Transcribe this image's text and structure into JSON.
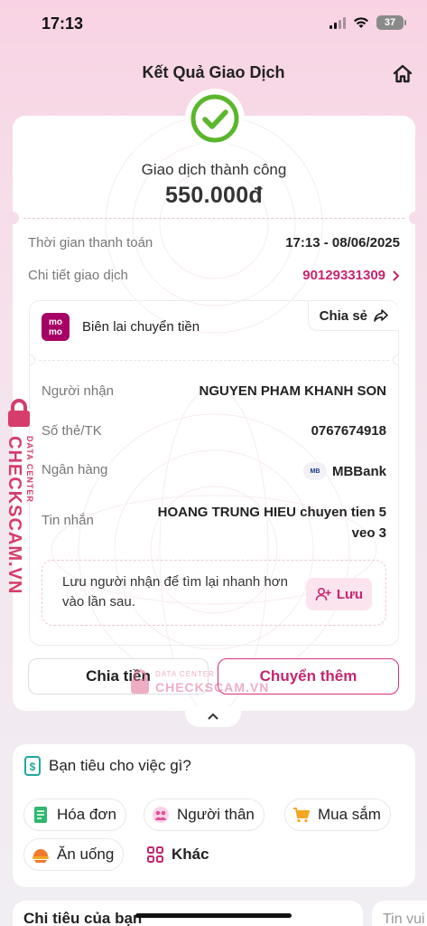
{
  "status_bar": {
    "time": "17:13",
    "battery": "37"
  },
  "header": {
    "title": "Kết Quả Giao Dịch"
  },
  "result": {
    "status": "Giao dịch thành công",
    "amount": "550.000đ",
    "payment_time_label": "Thời gian thanh toán",
    "payment_time_value": "17:13 - 08/06/2025",
    "detail_label": "Chi tiết giao dịch",
    "detail_value": "90129331309"
  },
  "receipt": {
    "logo_top": "mo",
    "logo_bottom": "mo",
    "title": "Biên lai chuyển tiền",
    "share_label": "Chia sẻ",
    "recipient_label": "Người nhận",
    "recipient_value": "NGUYEN PHAM KHANH SON",
    "account_label": "Số thẻ/TK",
    "account_value": "0767674918",
    "bank_label": "Ngân hàng",
    "bank_icon": "MB",
    "bank_value": "MBBank",
    "message_label": "Tin nhắn",
    "message_line1": "HOANG TRUNG HIEU chuyen tien 5",
    "message_line2": "veo 3",
    "save_text": "Lưu người nhận để tìm lại nhanh hơn vào lần sau.",
    "save_button": "Lưu"
  },
  "actions": {
    "split": "Chia tiền",
    "transfer_more": "Chuyển thêm"
  },
  "spending": {
    "title": "Bạn tiêu cho việc gì?",
    "categories": [
      {
        "label": "Hóa đơn",
        "icon": "bill-icon"
      },
      {
        "label": "Người thân",
        "icon": "family-icon"
      },
      {
        "label": "Mua sắm",
        "icon": "cart-icon"
      },
      {
        "label": "Ăn uống",
        "icon": "food-icon"
      },
      {
        "label": "Khác",
        "icon": "grid-icon"
      }
    ]
  },
  "bottom": {
    "card1_title": "Chi tiêu của bạn",
    "card2_title": "Tin vui"
  },
  "watermark": {
    "small": "DATA CENTER",
    "big": "CHECKSCAM.VN"
  },
  "colors": {
    "accent": "#c5266f",
    "success": "#5ab72c",
    "momo": "#a50064"
  }
}
